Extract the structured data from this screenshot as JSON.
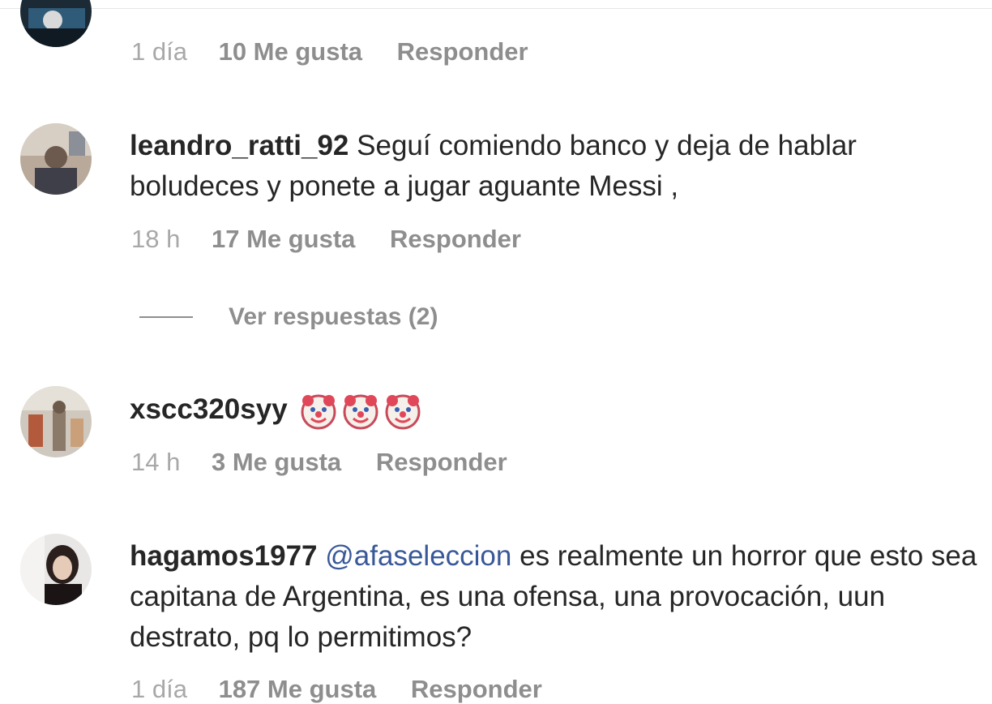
{
  "comments": [
    {
      "username": "",
      "text": "",
      "age": "1 día",
      "likes": "10 Me gusta",
      "reply": "Responder"
    },
    {
      "username": "leandro_ratti_92",
      "text": "Seguí comiendo banco y deja de hablar boludeces y ponete a jugar aguante Messi ,",
      "age": "18 h",
      "likes": "17 Me gusta",
      "reply": "Responder",
      "view_replies": "Ver respuestas (2)"
    },
    {
      "username": "xscc320syy",
      "text": "",
      "emojis": [
        "clown-face",
        "clown-face",
        "clown-face"
      ],
      "age": "14 h",
      "likes": "3 Me gusta",
      "reply": "Responder"
    },
    {
      "username": "hagamos1977",
      "mention": "@afaseleccion",
      "text": "es realmente un horror que esto sea capitana de Argentina, es una ofensa, una provocación, uun destrato, pq lo permitimos?",
      "age": "1 día",
      "likes": "187 Me gusta",
      "reply": "Responder"
    }
  ],
  "colors": {
    "text": "#262626",
    "meta": "#8e8e8e",
    "mention": "#385898"
  }
}
